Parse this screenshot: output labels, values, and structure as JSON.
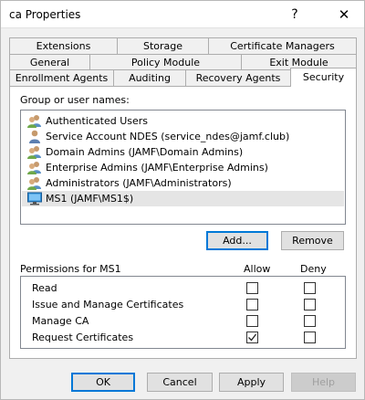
{
  "window": {
    "title": "ca Properties",
    "help_glyph": "?",
    "close_glyph": "✕"
  },
  "tabs": {
    "row1": [
      {
        "label": "Extensions"
      },
      {
        "label": "Storage"
      },
      {
        "label": "Certificate Managers"
      }
    ],
    "row2": [
      {
        "label": "General"
      },
      {
        "label": "Policy Module"
      },
      {
        "label": "Exit Module"
      }
    ],
    "row3": [
      {
        "label": "Enrollment Agents"
      },
      {
        "label": "Auditing"
      },
      {
        "label": "Recovery Agents"
      },
      {
        "label": "Security"
      }
    ],
    "active": "Security"
  },
  "security": {
    "group_label": "Group or user names:",
    "users": [
      {
        "name": "Authenticated Users",
        "icon": "group-icon"
      },
      {
        "name": "Service Account NDES (service_ndes@jamf.club)",
        "icon": "user-icon"
      },
      {
        "name": "Domain Admins (JAMF\\Domain Admins)",
        "icon": "group-icon"
      },
      {
        "name": "Enterprise Admins (JAMF\\Enterprise Admins)",
        "icon": "group-icon"
      },
      {
        "name": "Administrators (JAMF\\Administrators)",
        "icon": "group-icon"
      },
      {
        "name": "MS1 (JAMF\\MS1$)",
        "icon": "computer-icon",
        "selected": true
      }
    ],
    "add_label": "Add...",
    "remove_label": "Remove",
    "permissions_label": "Permissions for MS1",
    "allow_header": "Allow",
    "deny_header": "Deny",
    "permissions": [
      {
        "name": "Read",
        "allow": false,
        "deny": false
      },
      {
        "name": "Issue and Manage Certificates",
        "allow": false,
        "deny": false
      },
      {
        "name": "Manage CA",
        "allow": false,
        "deny": false
      },
      {
        "name": "Request Certificates",
        "allow": true,
        "deny": false
      }
    ]
  },
  "footer": {
    "ok": "OK",
    "cancel": "Cancel",
    "apply": "Apply",
    "help": "Help"
  },
  "colors": {
    "dialog_bg": "#f0f0f0",
    "accent": "#0078d7",
    "selection": "#e5e5e5"
  }
}
